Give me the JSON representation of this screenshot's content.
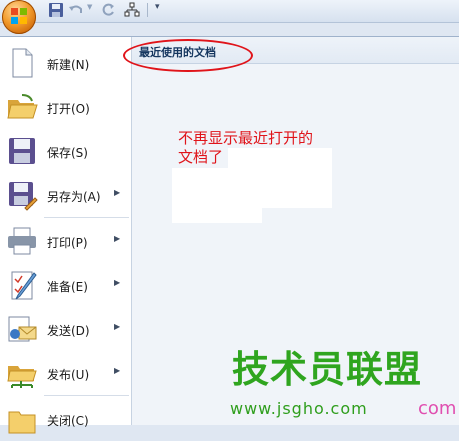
{
  "quick_access": {
    "buttons": [
      "save-icon",
      "undo-icon",
      "redo-icon",
      "org-chart-icon",
      "customize-dropdown-icon"
    ]
  },
  "menu": {
    "items": [
      {
        "label": "新建(N)",
        "icon": "new-document-icon",
        "has_submenu": false
      },
      {
        "label": "打开(O)",
        "icon": "open-folder-icon",
        "has_submenu": false
      },
      {
        "label": "保存(S)",
        "icon": "save-disk-icon",
        "has_submenu": false
      },
      {
        "label": "另存为(A)",
        "icon": "save-as-icon",
        "has_submenu": true
      },
      {
        "label": "打印(P)",
        "icon": "printer-icon",
        "has_submenu": true
      },
      {
        "label": "准备(E)",
        "icon": "prepare-icon",
        "has_submenu": true
      },
      {
        "label": "发送(D)",
        "icon": "send-icon",
        "has_submenu": true
      },
      {
        "label": "发布(U)",
        "icon": "publish-icon",
        "has_submenu": true
      },
      {
        "label": "关闭(C)",
        "icon": "close-folder-icon",
        "has_submenu": false
      }
    ]
  },
  "recent": {
    "title": "最近使用的文档",
    "annotation_line1": "不再显示最近打开的",
    "annotation_line2": "文档了"
  },
  "watermark": {
    "main": "技术员联盟",
    "url": "www.jsgho.com",
    "suffix": "com"
  },
  "colors": {
    "annotation_red": "#e0141a",
    "watermark_green": "#2fa51f",
    "title_blue": "#15365f"
  }
}
